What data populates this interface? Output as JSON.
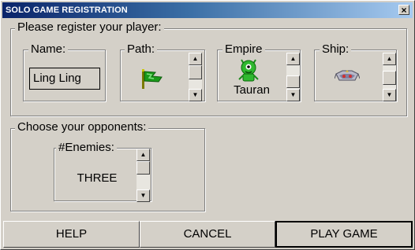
{
  "window": {
    "title": "SOLO GAME REGISTRATION",
    "close_label": "×"
  },
  "register_group": {
    "legend": "Please register your player:",
    "name": {
      "legend": "Name:",
      "value": "Ling Ling"
    },
    "path": {
      "legend": "Path:",
      "icon": "green-flag-icon"
    },
    "empire": {
      "legend": "Empire",
      "value": "Tauran",
      "icon": "green-alien-icon"
    },
    "ship": {
      "legend": "Ship:",
      "icon": "spaceship-icon"
    }
  },
  "opponents_group": {
    "legend": "Choose your opponents:",
    "enemies": {
      "legend": "#Enemies:",
      "value": "THREE"
    }
  },
  "buttons": {
    "help": "HELP",
    "cancel": "CANCEL",
    "play": "PLAY GAME"
  },
  "colors": {
    "face": "#d4d0c8",
    "title_start": "#0a246a",
    "title_end": "#a6caf0",
    "alien_green": "#2fb82f"
  }
}
